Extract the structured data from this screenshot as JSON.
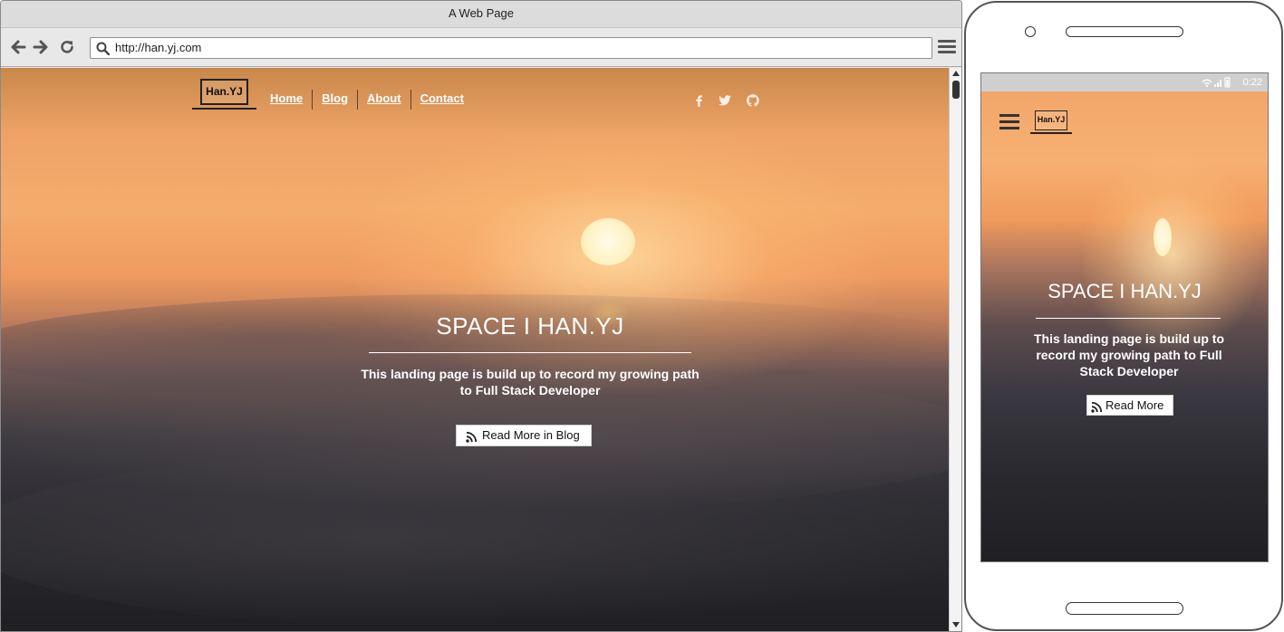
{
  "browser": {
    "title": "A Web Page",
    "url": "http://han.yj.com",
    "icons": [
      "back-arrow-icon",
      "forward-arrow-icon",
      "reload-icon",
      "search-icon",
      "menu-icon"
    ]
  },
  "site": {
    "logo_text": "Han.YJ",
    "nav": [
      "Home",
      "Blog",
      "About",
      "Contact"
    ],
    "social_icons": [
      "facebook-icon",
      "twitter-icon",
      "github-icon"
    ],
    "hero": {
      "title": "SPACE I HAN.YJ",
      "desc_plain": "This landing page is build up to record my growing path to",
      "desc_bold": "Full Stack Developer",
      "button": "Read More in Blog"
    }
  },
  "mobile": {
    "status_time": "0:22",
    "logo_text": "Han.YJ",
    "hero": {
      "title": "SPACE I HAN.YJ",
      "desc_plain": "This landing page is build up to record my growing path to",
      "desc_bold": "Full Stack Developer",
      "button": "Read More"
    }
  },
  "colors": {
    "text_on_image": "#ffffff",
    "logo_stroke": "#222222",
    "chrome_bg": "#dcdcdc"
  }
}
